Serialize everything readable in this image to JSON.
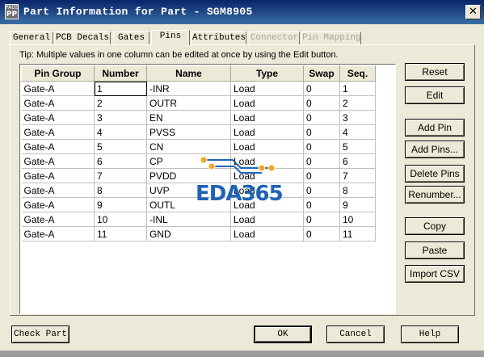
{
  "window": {
    "app_icon_label": "PADS",
    "app_icon_mark": "PP",
    "title": "Part Information for Part - SGM8905",
    "close_glyph": "✕"
  },
  "tabs": [
    {
      "label": "General"
    },
    {
      "label": "PCB Decals"
    },
    {
      "label": "Gates"
    },
    {
      "label": "Pins"
    },
    {
      "label": "Attributes"
    },
    {
      "label": "Connector"
    },
    {
      "label": "Pin Mapping"
    }
  ],
  "tip": "Tip: Multiple values in one column can be edited at once by using the Edit button.",
  "grid": {
    "columns": [
      "Pin Group",
      "Number",
      "Name",
      "Type",
      "Swap",
      "Seq."
    ],
    "rows": [
      [
        "Gate-A",
        "1",
        "-INR",
        "Load",
        "0",
        "1"
      ],
      [
        "Gate-A",
        "2",
        "OUTR",
        "Load",
        "0",
        "2"
      ],
      [
        "Gate-A",
        "3",
        "EN",
        "Load",
        "0",
        "3"
      ],
      [
        "Gate-A",
        "4",
        "PVSS",
        "Load",
        "0",
        "4"
      ],
      [
        "Gate-A",
        "5",
        "CN",
        "Load",
        "0",
        "5"
      ],
      [
        "Gate-A",
        "6",
        "CP",
        "Load",
        "0",
        "6"
      ],
      [
        "Gate-A",
        "7",
        "PVDD",
        "Load",
        "0",
        "7"
      ],
      [
        "Gate-A",
        "8",
        "UVP",
        "Load",
        "0",
        "8"
      ],
      [
        "Gate-A",
        "9",
        "OUTL",
        "Load",
        "0",
        "9"
      ],
      [
        "Gate-A",
        "10",
        "-INL",
        "Load",
        "0",
        "10"
      ],
      [
        "Gate-A",
        "11",
        "GND",
        "Load",
        "0",
        "11"
      ]
    ]
  },
  "side_buttons": {
    "reset": "Reset",
    "edit": "Edit",
    "add_pin": "Add Pin",
    "add_pins": "Add Pins...",
    "delete_pins": "Delete Pins",
    "renumber": "Renumber...",
    "copy": "Copy",
    "paste": "Paste",
    "import_csv": "Import CSV"
  },
  "footer_buttons": {
    "check_part": "Check Part",
    "ok": "OK",
    "cancel": "Cancel",
    "help": "Help"
  },
  "watermark": {
    "text": "EDA365"
  },
  "colors": {
    "titlebar": "#0a246a",
    "dialog": "#ece9d8",
    "watermark": "#1e63b6",
    "watermark_dots": "#f5a623"
  }
}
